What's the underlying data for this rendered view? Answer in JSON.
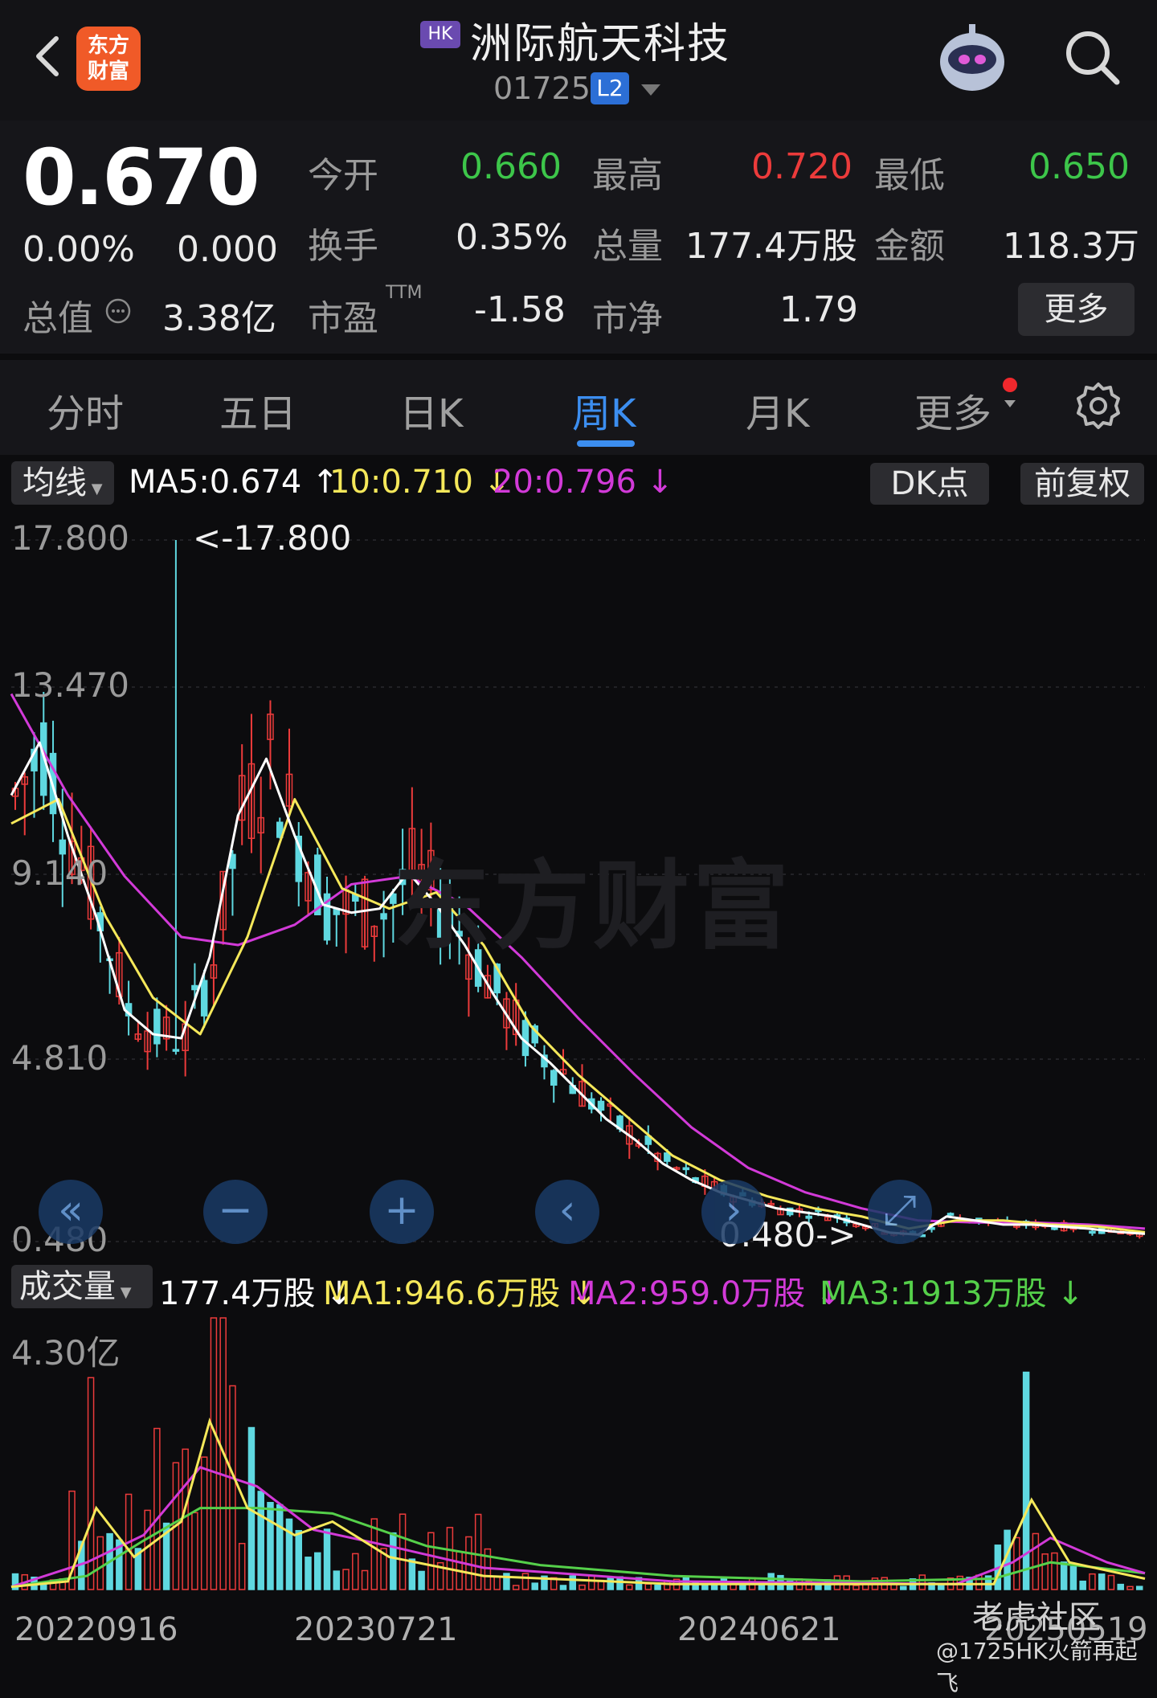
{
  "header": {
    "logo_text_1": "东方",
    "logo_text_2": "财富",
    "market_badge": "HK",
    "stock_name": "洲际航天科技",
    "stock_code": "01725",
    "l2_badge": "L2"
  },
  "quote": {
    "price": "0.670",
    "change_pct": "0.00%",
    "change_amt": "0.000",
    "market_cap_label": "总值",
    "market_cap_value": "3.38亿",
    "open_label": "今开",
    "open_value": "0.660",
    "high_label": "最高",
    "high_value": "0.720",
    "low_label": "最低",
    "low_value": "0.650",
    "turnover_label": "换手",
    "turnover_value": "0.35%",
    "volume_label": "总量",
    "volume_value": "177.4万股",
    "amount_label": "金额",
    "amount_value": "118.3万",
    "pe_label": "市盈",
    "pe_sup": "TTM",
    "pe_value": "-1.58",
    "pb_label": "市净",
    "pb_value": "1.79",
    "more_label": "更多"
  },
  "tabs": [
    "分时",
    "五日",
    "日K",
    "周K",
    "月K",
    "更多"
  ],
  "active_tab": "周K",
  "ma_bar": {
    "selector": "均线",
    "ma5": "MA5:0.674",
    "ma10": "10:0.710",
    "ma20": "20:0.796",
    "dk_button": "DK点",
    "adjust_button": "前复权"
  },
  "vol_bar": {
    "selector": "成交量",
    "vol": "177.4万股",
    "ma1": "MA1:946.6万股",
    "ma2": "MA2:959.0万股",
    "ma3": "MA3:1913万股"
  },
  "price_axis": [
    "17.800",
    "13.470",
    "9.140",
    "4.810",
    "0.480"
  ],
  "annotations": {
    "max_marker": "<-17.800",
    "min_marker": "0.480->"
  },
  "watermark": "东方财富",
  "volume_axis_top": "4.30亿",
  "dates": [
    "20220916",
    "20230721",
    "20240621",
    "20250519"
  ],
  "footer": {
    "community": "老虎社区",
    "credit": "@1725HK火箭再起飞"
  },
  "colors": {
    "up": "#ec3b3b",
    "down": "#5fd8e0",
    "ma5": "#ffffff",
    "ma10": "#f5e85a",
    "ma20": "#d23ad8",
    "vol_ma1": "#f5e85a",
    "vol_ma2": "#d23ad8",
    "vol_ma3": "#55d04a",
    "accent": "#3c8ef0"
  },
  "chart_data": {
    "type": "candlestick",
    "price_range": [
      0.48,
      17.8
    ],
    "ma5_path": [
      [
        0,
        11.5
      ],
      [
        3,
        12.8
      ],
      [
        6,
        10.5
      ],
      [
        9,
        8.5
      ],
      [
        12,
        6.2
      ],
      [
        15,
        5.6
      ],
      [
        18,
        5.5
      ],
      [
        21,
        7.5
      ],
      [
        24,
        11.0
      ],
      [
        27,
        12.4
      ],
      [
        30,
        10.5
      ],
      [
        33,
        8.8
      ],
      [
        36,
        8.6
      ],
      [
        39,
        8.7
      ],
      [
        42,
        9.6
      ],
      [
        45,
        8.8
      ],
      [
        48,
        7.8
      ],
      [
        51,
        6.6
      ],
      [
        54,
        5.5
      ],
      [
        57,
        4.9
      ],
      [
        60,
        4.2
      ],
      [
        63,
        3.5
      ],
      [
        66,
        3.0
      ],
      [
        69,
        2.4
      ],
      [
        72,
        2.0
      ],
      [
        75,
        1.7
      ],
      [
        78,
        1.5
      ],
      [
        81,
        1.3
      ],
      [
        84,
        1.2
      ],
      [
        87,
        1.1
      ],
      [
        90,
        0.9
      ],
      [
        93,
        0.7
      ],
      [
        96,
        0.65
      ],
      [
        99,
        1.1
      ],
      [
        102,
        1.0
      ],
      [
        105,
        0.9
      ],
      [
        108,
        0.9
      ],
      [
        111,
        0.85
      ],
      [
        114,
        0.8
      ],
      [
        117,
        0.72
      ],
      [
        120,
        0.67
      ]
    ],
    "ma10_path": [
      [
        0,
        10.8
      ],
      [
        5,
        11.4
      ],
      [
        10,
        8.5
      ],
      [
        15,
        6.5
      ],
      [
        20,
        5.6
      ],
      [
        25,
        8.0
      ],
      [
        30,
        11.4
      ],
      [
        35,
        9.2
      ],
      [
        40,
        8.7
      ],
      [
        45,
        9.1
      ],
      [
        50,
        7.8
      ],
      [
        55,
        5.8
      ],
      [
        60,
        4.6
      ],
      [
        65,
        3.6
      ],
      [
        70,
        2.6
      ],
      [
        75,
        2.0
      ],
      [
        80,
        1.6
      ],
      [
        85,
        1.3
      ],
      [
        90,
        1.1
      ],
      [
        95,
        0.8
      ],
      [
        100,
        1.0
      ],
      [
        105,
        1.0
      ],
      [
        110,
        0.9
      ],
      [
        115,
        0.85
      ],
      [
        120,
        0.71
      ]
    ],
    "ma20_path": [
      [
        0,
        14.0
      ],
      [
        6,
        11.5
      ],
      [
        12,
        9.5
      ],
      [
        18,
        8.0
      ],
      [
        24,
        7.8
      ],
      [
        30,
        8.3
      ],
      [
        36,
        9.3
      ],
      [
        42,
        9.5
      ],
      [
        48,
        8.8
      ],
      [
        54,
        7.5
      ],
      [
        60,
        6.0
      ],
      [
        66,
        4.6
      ],
      [
        72,
        3.3
      ],
      [
        78,
        2.3
      ],
      [
        84,
        1.7
      ],
      [
        90,
        1.3
      ],
      [
        96,
        1.0
      ],
      [
        102,
        0.95
      ],
      [
        108,
        0.95
      ],
      [
        114,
        0.9
      ],
      [
        120,
        0.8
      ]
    ],
    "series_volume_ma": [
      "MA1",
      "MA2",
      "MA3"
    ]
  }
}
